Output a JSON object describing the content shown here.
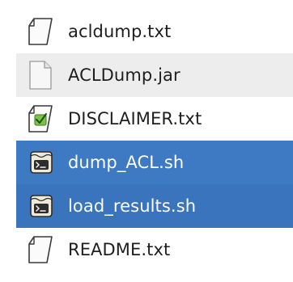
{
  "file_list": {
    "items": [
      {
        "name": "acldump.txt",
        "icon": "text-file-icon",
        "selected": false
      },
      {
        "name": "ACLDump.jar",
        "icon": "blank-file-icon",
        "selected": false
      },
      {
        "name": "DISCLAIMER.txt",
        "icon": "text-file-checked-icon",
        "selected": false
      },
      {
        "name": "dump_ACL.sh",
        "icon": "shell-script-icon",
        "selected": true
      },
      {
        "name": "load_results.sh",
        "icon": "shell-script-icon",
        "selected": true
      },
      {
        "name": "README.txt",
        "icon": "text-file-icon",
        "selected": false
      }
    ]
  },
  "colors": {
    "selection": "#3e7ac3",
    "alternate_row": "#ededed",
    "text": "#1e1e1e",
    "selected_text": "#ffffff"
  }
}
